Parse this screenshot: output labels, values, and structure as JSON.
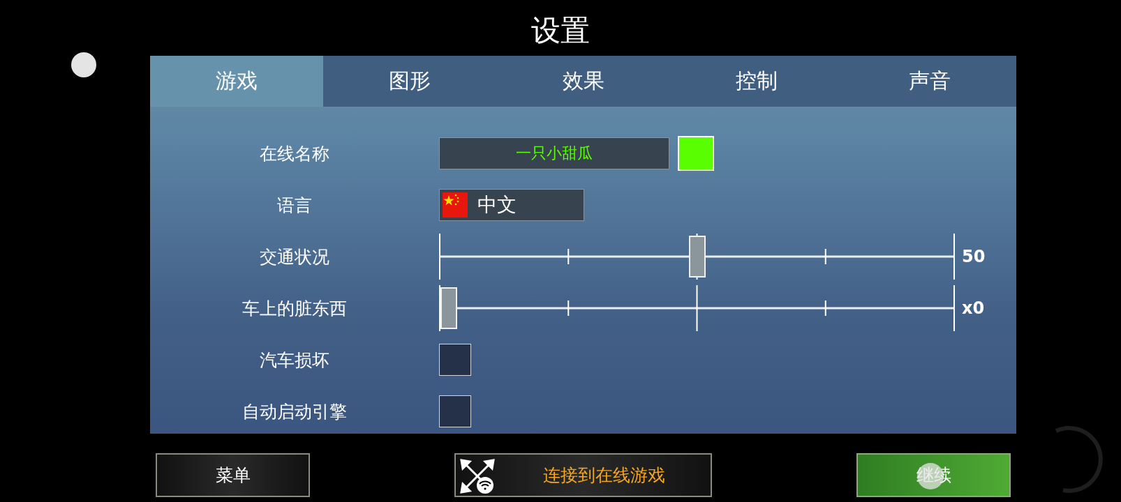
{
  "title": "设置",
  "tabs": [
    {
      "label": "游戏",
      "selected": true
    },
    {
      "label": "图形",
      "selected": false
    },
    {
      "label": "效果",
      "selected": false
    },
    {
      "label": "控制",
      "selected": false
    },
    {
      "label": "声音",
      "selected": false
    }
  ],
  "rows": [
    {
      "kind": "text_field",
      "label": "在线名称",
      "value": "一只小甜瓜",
      "color": "#59ff00"
    },
    {
      "kind": "language",
      "label": "语言",
      "value": "中文"
    },
    {
      "kind": "slider",
      "label": "交通状况",
      "level": 0.5,
      "reading": "50"
    },
    {
      "kind": "slider",
      "label": "车上的脏东西",
      "level": 0,
      "reading": "x0"
    },
    {
      "kind": "checkbox",
      "label": "汽车损坏",
      "checked": false
    },
    {
      "kind": "checkbox",
      "label": "自动启动引擎",
      "checked": false
    }
  ],
  "buttons": [
    {
      "kind": "menu",
      "label": "菜单"
    },
    {
      "kind": "online",
      "label": "连接到在线游戏"
    },
    {
      "kind": "continue",
      "label": "继续"
    }
  ]
}
